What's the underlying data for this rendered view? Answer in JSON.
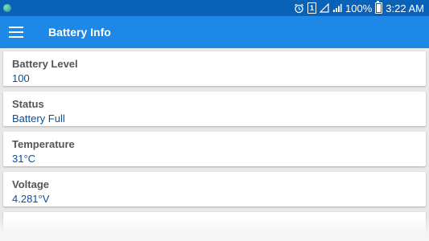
{
  "status_bar": {
    "battery_percent": "100%",
    "time": "3:22 AM",
    "sim_label": "1",
    "icons": [
      "app-icon",
      "alarm-icon",
      "sim-icon",
      "wifi-icon",
      "signal-icon",
      "battery-icon"
    ]
  },
  "app_bar": {
    "title": "Battery Info",
    "menu_icon": "hamburger-menu-icon"
  },
  "items": [
    {
      "label": "Battery Level",
      "value": "100"
    },
    {
      "label": "Status",
      "value": "Battery Full"
    },
    {
      "label": "Temperature",
      "value": "31°C"
    },
    {
      "label": "Voltage",
      "value": "4.281°V"
    }
  ],
  "colors": {
    "status_bar": "#0a62b8",
    "app_bar": "#1d88e5",
    "value_text": "#0a4e9b",
    "label_text": "#555555",
    "background": "#e9e9e9"
  }
}
